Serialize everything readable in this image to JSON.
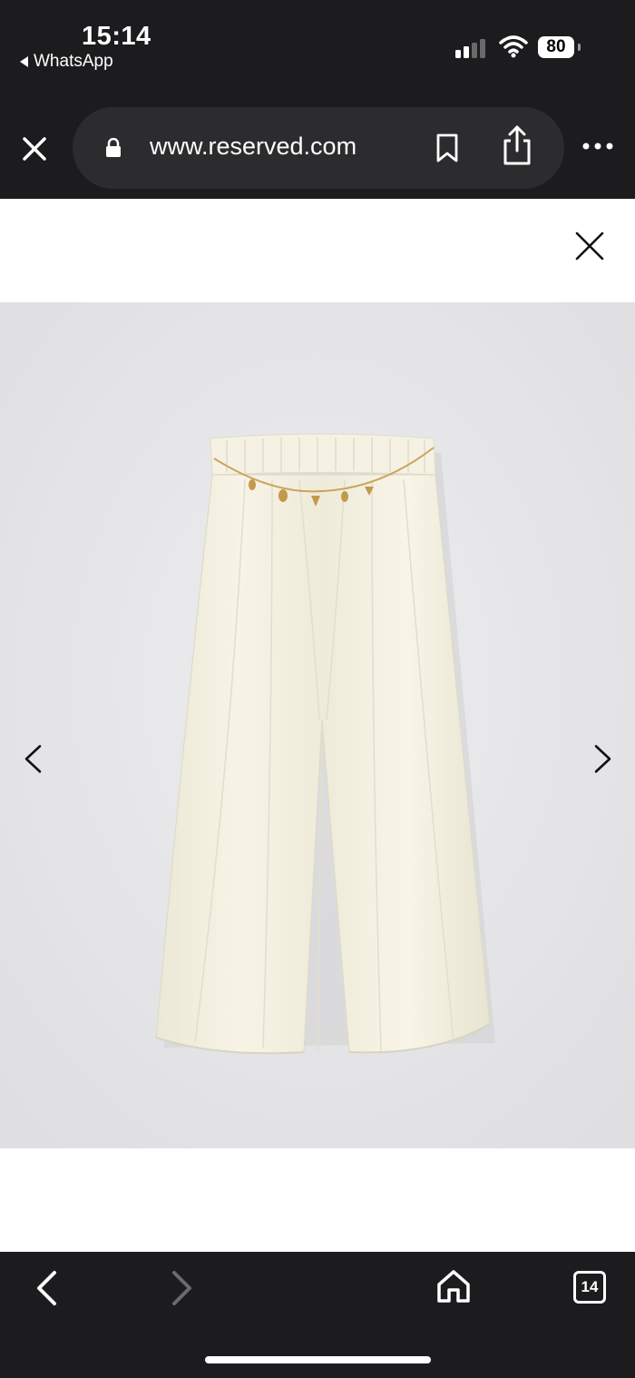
{
  "status_bar": {
    "time": "15:14",
    "back_app": "WhatsApp",
    "battery": "80",
    "icons": [
      "signal-icon",
      "wifi-icon",
      "battery-icon"
    ]
  },
  "browser": {
    "url": "www.reserved.com",
    "icons": [
      "close-icon",
      "lock-icon",
      "bookmark-icon",
      "share-icon",
      "more-icon"
    ]
  },
  "toolbar": {
    "tab_count": "14",
    "icons": [
      "back-icon",
      "forward-icon",
      "home-icon",
      "tabs-icon"
    ]
  },
  "gallery": {
    "product_image": "cream wide-leg trousers with gold chain belt",
    "icons": [
      "chevron-left-icon",
      "chevron-right-icon"
    ]
  },
  "colors": {
    "chrome": "#1c1c1e",
    "pill": "#2c2c2e",
    "gallery_bg": "#e6e6e8",
    "fabric": "#f4f1e3"
  }
}
